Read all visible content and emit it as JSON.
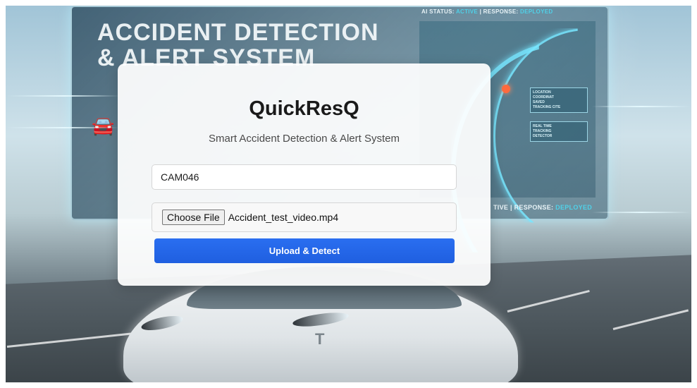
{
  "background": {
    "board_title": "ACCIDENT DETECTION\n& ALERT SYSTEM",
    "status_top": {
      "prefix": "AI STATUS: ",
      "active": "ACTIVE",
      "sep": " | RESPONSE: ",
      "deployed": "DEPLOYED"
    },
    "status_bottom": {
      "prefix": "TIVE | RESPONSE: ",
      "deployed": "DEPLOYED"
    },
    "map_box_1": "LOCATION\nCOORDINAT\nSAVED\nTRACKING CITE",
    "map_box_2": "REAL TIME\nTRACKING\nDETECTOR",
    "car_logo": "T"
  },
  "card": {
    "title": "QuickResQ",
    "subtitle": "Smart Accident Detection & Alert System"
  },
  "form": {
    "camera_id_value": "CAM046",
    "choose_file_label": "Choose File",
    "selected_file_name": "Accident_test_video.mp4",
    "submit_label": "Upload & Detect"
  },
  "colors": {
    "accent": "#1f5fe0",
    "status_accent": "#4fd1e8"
  }
}
